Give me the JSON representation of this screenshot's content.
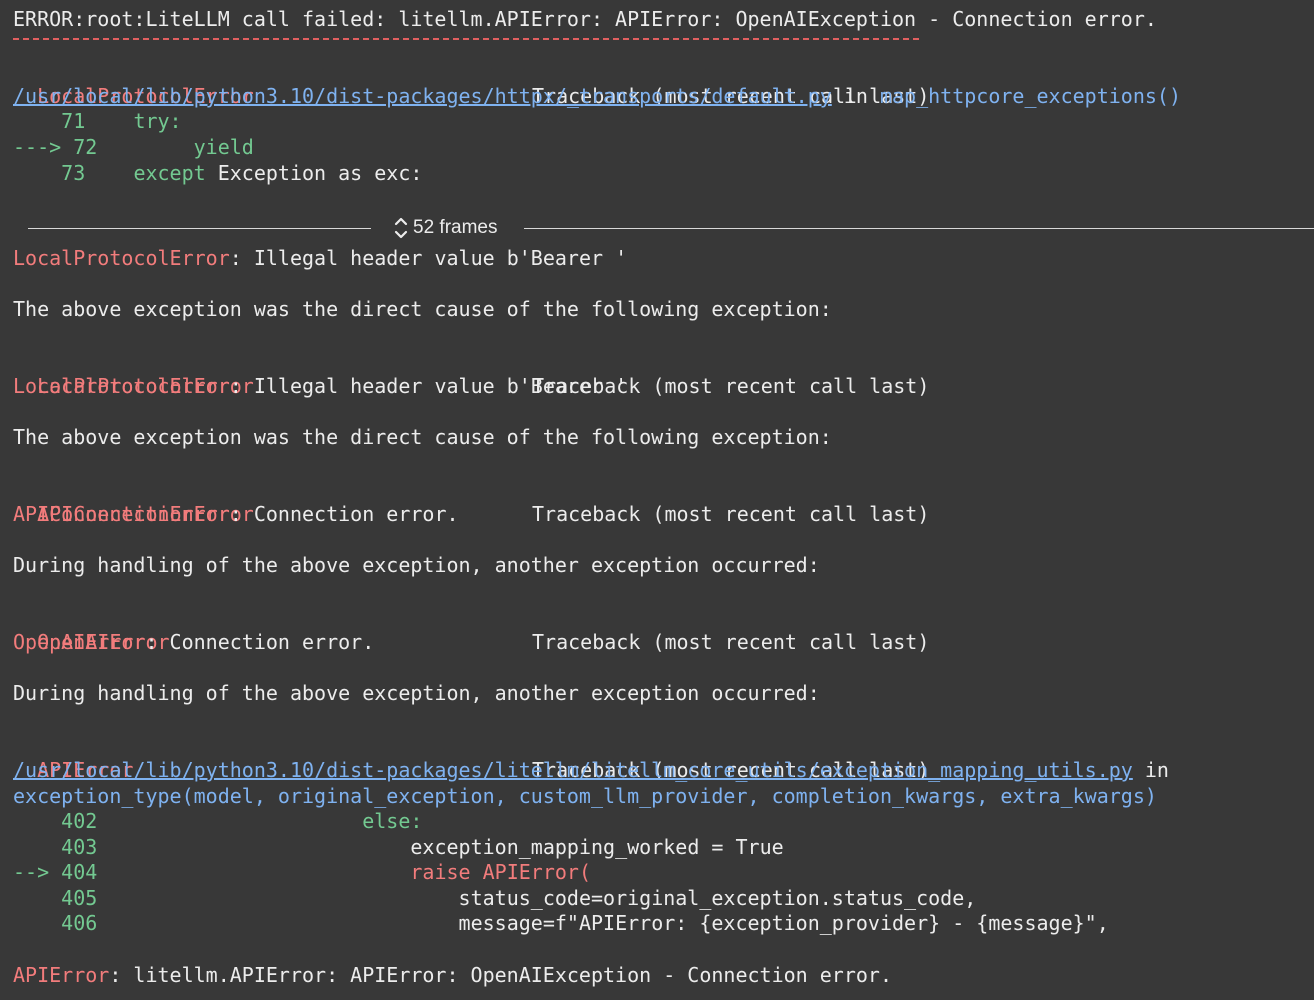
{
  "colors": {
    "background": "#383838",
    "text": "#ececec",
    "error_name": "#f27c7c",
    "link": "#7fb2f0",
    "line_number": "#73c991"
  },
  "log_line": "ERROR:root:LiteLLM call failed: litellm.APIError: APIError: OpenAIException - Connection error.",
  "traceback_label": "Traceback (most recent call last)",
  "in_word": " in",
  "block1": {
    "error_name": "LocalProtocolError",
    "file_path": "/usr/local/lib/python3.10/dist-packages/httpx/_transports/default.py",
    "function": "map_httpcore_exceptions()",
    "code": [
      {
        "marker": "    ",
        "num": "71",
        "indent": "    ",
        "text_a": "try:",
        "text_b": ""
      },
      {
        "marker": "---> ",
        "num": "72",
        "indent": "        ",
        "text_a": "yield",
        "text_b": ""
      },
      {
        "marker": "    ",
        "num": "73",
        "indent": "    ",
        "text_a": "except",
        "text_b": " Exception as exc:"
      }
    ],
    "frames_label": "52 frames",
    "error_message": ": Illegal header value b'Bearer '"
  },
  "cause_text": "The above exception was the direct cause of the following exception:",
  "during_text": "During handling of the above exception, another exception occurred:",
  "block2": {
    "error_name": "LocalProtocolError",
    "error_message": ": Illegal header value b'Bearer '"
  },
  "block3": {
    "error_name": "APIConnectionError",
    "error_message": ": Connection error."
  },
  "block4": {
    "error_name": "OpenAIError",
    "error_message": ": Connection error."
  },
  "block5": {
    "error_name": "APIError",
    "file_path": "/usr/local/lib/python3.10/dist-packages/litellm/litellm_core_utils/exception_mapping_utils.py",
    "function_sig": "exception_type(model, original_exception, custom_llm_provider, completion_kwargs, extra_kwargs)",
    "code": [
      {
        "num": "402",
        "text": "else:"
      },
      {
        "num": "403",
        "text": "exception_mapping_worked = True"
      },
      {
        "num": "404",
        "text": "raise APIError("
      },
      {
        "num": "405",
        "text": "status_code=original_exception.status_code,"
      },
      {
        "num": "406",
        "text": "message=f\"APIError: {exception_provider} - {message}\","
      }
    ],
    "arrow": "--> ",
    "final_message": ": litellm.APIError: APIError: OpenAIException - Connection error."
  }
}
